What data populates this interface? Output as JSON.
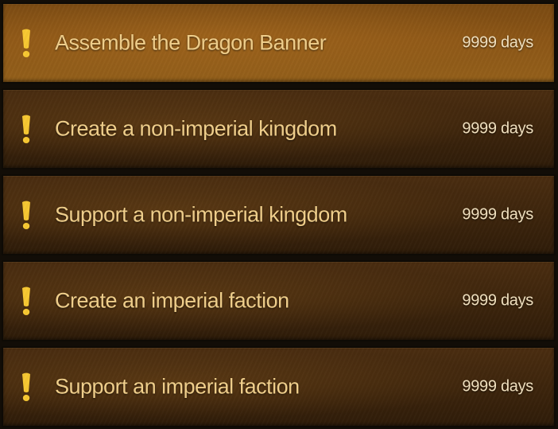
{
  "icon": "exclamation-icon",
  "accent_color": "#f5c33b",
  "quests": [
    {
      "title": "Assemble the Dragon Banner",
      "days": "9999 days",
      "selected": true
    },
    {
      "title": "Create a non-imperial kingdom",
      "days": "9999 days",
      "selected": false
    },
    {
      "title": "Support a non-imperial kingdom",
      "days": "9999 days",
      "selected": false
    },
    {
      "title": "Create an imperial faction",
      "days": "9999 days",
      "selected": false
    },
    {
      "title": "Support an imperial faction",
      "days": "9999 days",
      "selected": false
    }
  ]
}
